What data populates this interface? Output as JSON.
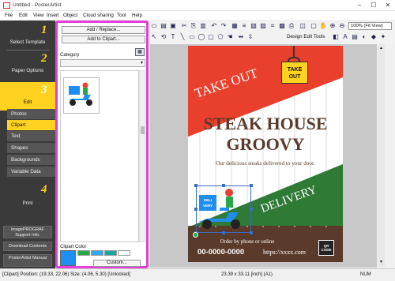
{
  "window": {
    "title": "Untitled - PosterArtist"
  },
  "menu": [
    "File",
    "Edit",
    "View",
    "Insert",
    "Object",
    "Cloud sharing",
    "Tool",
    "Help"
  ],
  "nav": {
    "steps": [
      {
        "num": "1",
        "label": "Select Template"
      },
      {
        "num": "2",
        "label": "Paper Options"
      },
      {
        "num": "3",
        "label": "Edit"
      },
      {
        "num": "4",
        "label": "Print"
      }
    ],
    "edit_items": [
      "Photos",
      "Clipart",
      "Text",
      "Shapes",
      "Backgrounds",
      "Variable Data"
    ],
    "active_item": "Clipart",
    "bottom": {
      "support": "imagePROGRAF Support Info.",
      "download": "Download Contents",
      "manual": "PosterArtist Manual"
    }
  },
  "panel": {
    "add_replace": "Add / Replace...",
    "add_clipart": "Add to Clipart...",
    "category_label": "Category",
    "clipart_color_label": "Clipart Color",
    "custom_button": "Custom...",
    "swatches": [
      "#1e8ef0",
      "#2aa64a",
      "#33a8e8",
      "#18a8a0",
      "#ffffff"
    ]
  },
  "toolbar": {
    "zoom": "100% (Fit View)",
    "design_tools": "Design Edit Tools"
  },
  "poster": {
    "take_out_banner": "TAKE OUT",
    "badge_line1": "TAKE",
    "badge_line2": "OUT",
    "title_line1": "STEAK HOUSE",
    "title_line2": "GROOVY",
    "subtitle": "Our delicious steaks delivered to your door.",
    "delivery": "DELIVERY",
    "scooter_box_1": "DELI",
    "scooter_box_2": "VERY",
    "order_text": "Order by phone or online",
    "phone": "00-0000-0000",
    "url": "https://xxxx.com",
    "qr_label": "QR CODE",
    "colors": {
      "red": "#e8402c",
      "green": "#2f7a35",
      "brown": "#5a3a2a",
      "yellow": "#ffd21f"
    }
  },
  "status": {
    "left": "[Clipart] Position: (19.33, 22.06) Size: (4.06, 5.30) [Unlocked]",
    "center": "23.39 x 33.11 [inch] (A1)",
    "right": "NUM"
  }
}
